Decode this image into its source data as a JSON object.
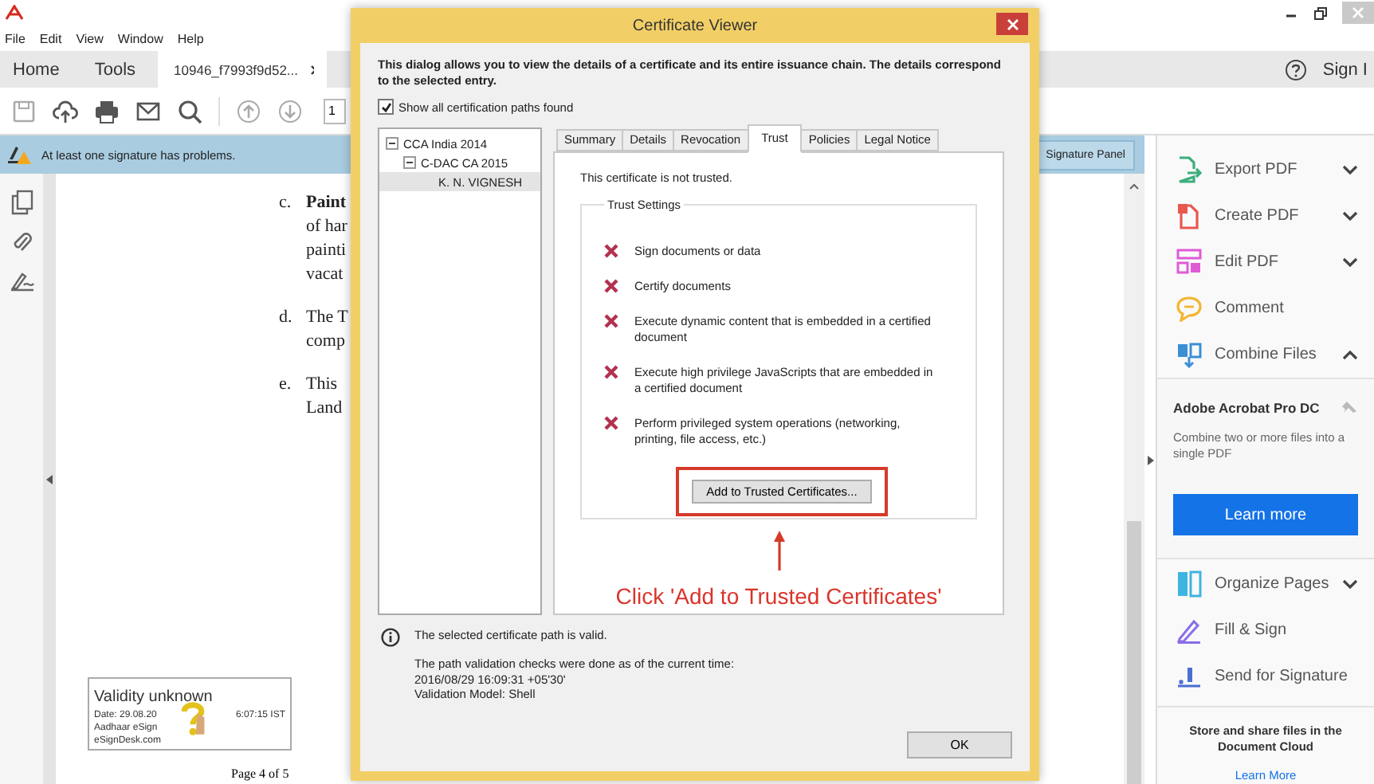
{
  "menu": [
    "File",
    "Edit",
    "View",
    "Window",
    "Help"
  ],
  "nav_tabs": [
    {
      "kind": "section",
      "label": "Home",
      "selected": false
    },
    {
      "kind": "section",
      "label": "Tools",
      "selected": false
    },
    {
      "kind": "document",
      "label": "10946_f7993f9d52...",
      "selected": true
    }
  ],
  "sign_in": "Sign I",
  "toolbar": {
    "page_number": "1"
  },
  "signature_bar": {
    "message": "At least one signature has problems.",
    "button": "Signature Panel"
  },
  "document": {
    "items": [
      {
        "marker": "c.",
        "heading": "Paint",
        "lines": [
          "of har",
          "painti",
          "vacat"
        ]
      },
      {
        "marker": "d.",
        "lines": [
          "The T",
          "comp"
        ]
      },
      {
        "marker": "e.",
        "lines": [
          "This",
          "Land"
        ]
      }
    ],
    "stamp": {
      "title": "Validity unknown",
      "lines": [
        [
          "Date: 29.08.20",
          "6:07:15 IST"
        ],
        [
          "Aadhaar eSign"
        ],
        [
          "eSignDesk.com"
        ]
      ]
    },
    "page_label": "Page 4 of 5"
  },
  "tools_pane": {
    "items": [
      {
        "label": "Export PDF",
        "color": "#3aae7c",
        "kind": "expandable",
        "expanded": false
      },
      {
        "label": "Create PDF",
        "color": "#e8584e",
        "kind": "expandable",
        "expanded": false
      },
      {
        "label": "Edit PDF",
        "color": "#df5bd6",
        "kind": "expandable",
        "expanded": false
      },
      {
        "label": "Comment",
        "color": "#f2b632",
        "kind": "plain"
      },
      {
        "label": "Combine Files",
        "color": "#3b8fd6",
        "kind": "expandable",
        "expanded": true,
        "details": {
          "title": "Adobe Acrobat Pro DC",
          "text": "Combine two or more files into a single PDF",
          "button": "Learn more"
        }
      },
      {
        "label": "Organize Pages",
        "color": "#3fb4e0",
        "kind": "expandable",
        "expanded": false
      },
      {
        "label": "Fill & Sign",
        "color": "#8a6ee8",
        "kind": "plain"
      },
      {
        "label": "Send for Signature",
        "color": "#4a6fd1",
        "kind": "plain"
      }
    ],
    "footer": {
      "text": "Store and share files in the Document Cloud",
      "link": "Learn More"
    }
  },
  "dialog": {
    "title": "Certificate Viewer",
    "description": "This dialog allows you to view the details of a certificate and its entire issuance chain. The details correspond to the selected entry.",
    "show_all_paths": {
      "label": "Show all certification paths found",
      "checked": true
    },
    "tree": [
      {
        "label": "CCA India 2014",
        "expanded": true,
        "selected": false,
        "children": [
          {
            "label": "C-DAC CA 2015",
            "expanded": true,
            "selected": false,
            "children": [
              {
                "label": "K. N. VIGNESH",
                "selected": true
              }
            ]
          }
        ]
      }
    ],
    "tabs": [
      {
        "label": "Summary",
        "selected": false
      },
      {
        "label": "Details",
        "selected": false
      },
      {
        "label": "Revocation",
        "selected": false
      },
      {
        "label": "Trust",
        "selected": true
      },
      {
        "label": "Policies",
        "selected": false
      },
      {
        "label": "Legal Notice",
        "selected": false
      }
    ],
    "trust": {
      "status": "This certificate is not trusted.",
      "group_title": "Trust Settings",
      "settings": [
        {
          "label": "Sign documents or data",
          "allowed": false
        },
        {
          "label": "Certify documents",
          "allowed": false
        },
        {
          "label": "Execute dynamic content that is embedded in a certified document",
          "allowed": false
        },
        {
          "label": "Execute high privilege JavaScripts that are embedded in a certified document",
          "allowed": false
        },
        {
          "label": "Perform privileged system operations (networking, printing, file access, etc.)",
          "allowed": false
        }
      ],
      "button": "Add to Trusted Certificates..."
    },
    "annotation": {
      "text": "Click 'Add to Trusted Certificates'"
    },
    "validity": {
      "message": "The selected certificate path is valid.",
      "details": [
        "The path validation checks were done as of the current time:",
        "2016/08/29 16:09:31 +05'30'",
        "Validation Model: Shell"
      ]
    },
    "ok_button": "OK"
  }
}
